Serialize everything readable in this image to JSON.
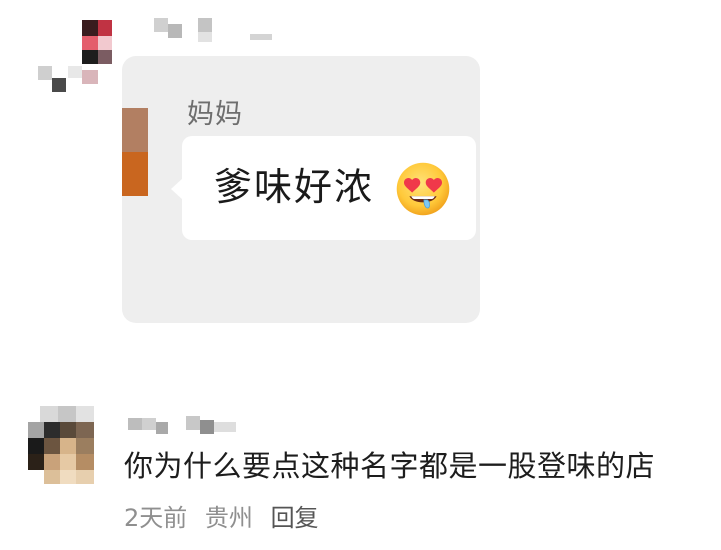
{
  "top_comment": {
    "screenshot": {
      "sender_name": "妈妈",
      "message": "爹味好浓",
      "emoji": "heart-eyes-drooling-face"
    }
  },
  "bottom_comment": {
    "text": "你为什么要点这种名字都是一股登味的店",
    "time": "2天前",
    "location": "贵州",
    "reply_label": "回复"
  }
}
